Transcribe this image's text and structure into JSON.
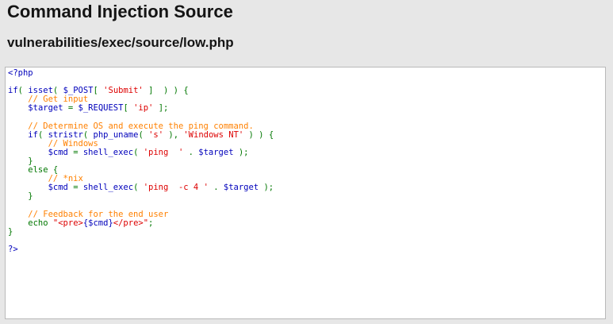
{
  "page": {
    "title": "Command Injection Source",
    "file_path": "vulnerabilities/exec/source/low.php"
  },
  "code": {
    "lines": [
      [
        {
          "t": "d",
          "v": "<?php"
        }
      ],
      [],
      [
        {
          "t": "d",
          "v": "if"
        },
        {
          "t": "k",
          "v": "( "
        },
        {
          "t": "d",
          "v": "isset"
        },
        {
          "t": "k",
          "v": "( "
        },
        {
          "t": "d",
          "v": "$_POST"
        },
        {
          "t": "k",
          "v": "[ "
        },
        {
          "t": "s",
          "v": "'Submit'"
        },
        {
          "t": "k",
          "v": " ]  ) ) {"
        }
      ],
      [
        {
          "t": "k",
          "v": "    "
        },
        {
          "t": "c",
          "v": "// Get input"
        }
      ],
      [
        {
          "t": "k",
          "v": "    "
        },
        {
          "t": "d",
          "v": "$target"
        },
        {
          "t": "k",
          "v": " = "
        },
        {
          "t": "d",
          "v": "$_REQUEST"
        },
        {
          "t": "k",
          "v": "[ "
        },
        {
          "t": "s",
          "v": "'ip'"
        },
        {
          "t": "k",
          "v": " ];"
        }
      ],
      [],
      [
        {
          "t": "k",
          "v": "    "
        },
        {
          "t": "c",
          "v": "// Determine OS and execute the ping command."
        }
      ],
      [
        {
          "t": "k",
          "v": "    "
        },
        {
          "t": "d",
          "v": "if"
        },
        {
          "t": "k",
          "v": "( "
        },
        {
          "t": "d",
          "v": "stristr"
        },
        {
          "t": "k",
          "v": "( "
        },
        {
          "t": "d",
          "v": "php_uname"
        },
        {
          "t": "k",
          "v": "( "
        },
        {
          "t": "s",
          "v": "'s'"
        },
        {
          "t": "k",
          "v": " ), "
        },
        {
          "t": "s",
          "v": "'Windows NT'"
        },
        {
          "t": "k",
          "v": " ) ) {"
        }
      ],
      [
        {
          "t": "k",
          "v": "        "
        },
        {
          "t": "c",
          "v": "// Windows"
        }
      ],
      [
        {
          "t": "k",
          "v": "        "
        },
        {
          "t": "d",
          "v": "$cmd"
        },
        {
          "t": "k",
          "v": " = "
        },
        {
          "t": "d",
          "v": "shell_exec"
        },
        {
          "t": "k",
          "v": "( "
        },
        {
          "t": "s",
          "v": "'ping  '"
        },
        {
          "t": "k",
          "v": " . "
        },
        {
          "t": "d",
          "v": "$target"
        },
        {
          "t": "k",
          "v": " );"
        }
      ],
      [
        {
          "t": "k",
          "v": "    }"
        }
      ],
      [
        {
          "t": "k",
          "v": "    else {"
        }
      ],
      [
        {
          "t": "k",
          "v": "        "
        },
        {
          "t": "c",
          "v": "// *nix"
        }
      ],
      [
        {
          "t": "k",
          "v": "        "
        },
        {
          "t": "d",
          "v": "$cmd"
        },
        {
          "t": "k",
          "v": " = "
        },
        {
          "t": "d",
          "v": "shell_exec"
        },
        {
          "t": "k",
          "v": "( "
        },
        {
          "t": "s",
          "v": "'ping  -c 4 '"
        },
        {
          "t": "k",
          "v": " . "
        },
        {
          "t": "d",
          "v": "$target"
        },
        {
          "t": "k",
          "v": " );"
        }
      ],
      [
        {
          "t": "k",
          "v": "    }"
        }
      ],
      [],
      [
        {
          "t": "k",
          "v": "    "
        },
        {
          "t": "c",
          "v": "// Feedback for the end user"
        }
      ],
      [
        {
          "t": "k",
          "v": "    echo "
        },
        {
          "t": "s",
          "v": "\"<pre>"
        },
        {
          "t": "d",
          "v": "{$cmd}"
        },
        {
          "t": "s",
          "v": "</pre>\""
        },
        {
          "t": "k",
          "v": ";"
        }
      ],
      [
        {
          "t": "k",
          "v": "}"
        }
      ],
      [],
      [
        {
          "t": "d",
          "v": "?>"
        }
      ]
    ]
  },
  "colors": {
    "background": "#e7e7e7",
    "code_background": "#ffffff",
    "keyword": "#007700",
    "string": "#dd0000",
    "comment": "#ff8000",
    "default": "#0000bb"
  }
}
